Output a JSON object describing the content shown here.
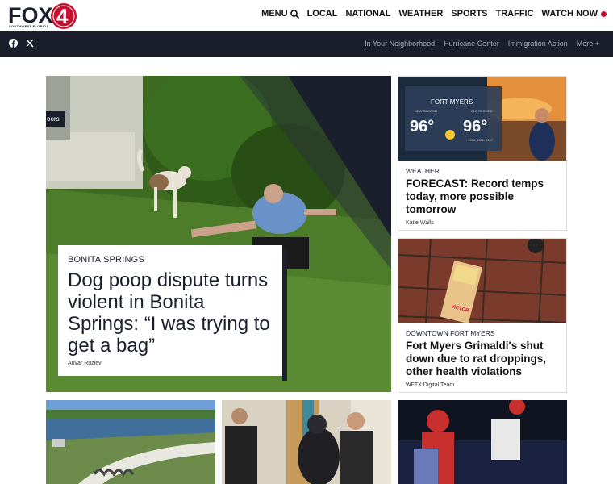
{
  "header": {
    "logo_text": "FOX",
    "logo_number": "4",
    "logo_tagline": "SOUTHWEST FLORIDA",
    "nav": [
      {
        "label": "MENU"
      },
      {
        "label": "LOCAL"
      },
      {
        "label": "NATIONAL"
      },
      {
        "label": "WEATHER"
      },
      {
        "label": "SPORTS"
      },
      {
        "label": "TRAFFIC"
      },
      {
        "label": "WATCH NOW"
      }
    ]
  },
  "subnav": {
    "social_icons": [
      "facebook-icon",
      "x-icon"
    ],
    "links": [
      "In Your Neighborhood",
      "Hurricane Center",
      "Immigration Action",
      "More +"
    ]
  },
  "hero": {
    "kicker": "BONITA SPRINGS",
    "title": "Dog poop dispute turns violent in Bonita Springs: “I was trying to get a bag”",
    "byline": "Anvar Ruziev",
    "image_tag_partial": "oors"
  },
  "side_stories": [
    {
      "kicker": "WEATHER",
      "title": "FORECAST: Record temps today, more possible tomorrow",
      "byline": "Katie Walls",
      "image": {
        "city": "FORT MYERS",
        "new_record": "96°",
        "old_record": "96°",
        "new_label": "NEW RECORD",
        "old_label": "OLD RECORD",
        "years": "1906, 1931, 2007"
      }
    },
    {
      "kicker": "DOWNTOWN FORT MYERS",
      "title": "Fort Myers Grimaldi's shut down due to rat droppings, other health violations",
      "byline": "WFTX Digital Team",
      "image": {
        "brand": "VICTOR"
      }
    }
  ],
  "colors": {
    "navy": "#1a1f2b",
    "brand_red": "#c8102e",
    "sub_link": "#a8adb8"
  }
}
